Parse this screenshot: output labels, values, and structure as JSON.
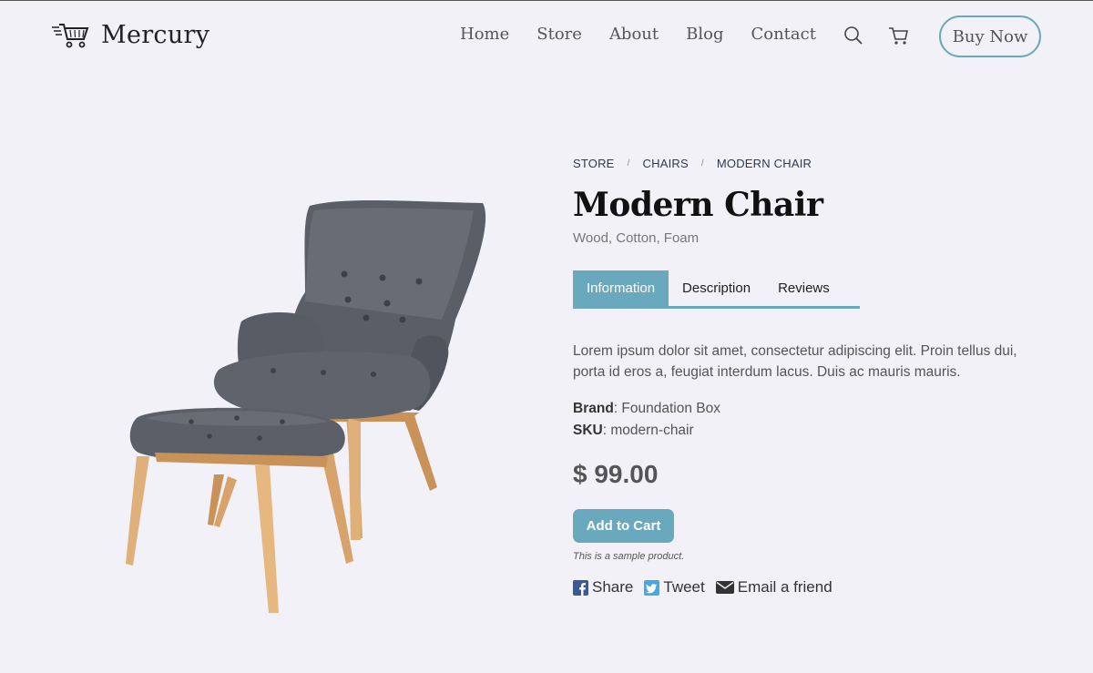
{
  "header": {
    "brand": "Mercury",
    "nav": [
      "Home",
      "Store",
      "About",
      "Blog",
      "Contact"
    ],
    "buy_now": "Buy Now"
  },
  "breadcrumb": [
    "STORE",
    "CHAIRS",
    "MODERN CHAIR"
  ],
  "product": {
    "title": "Modern Chair",
    "materials": "Wood, Cotton, Foam",
    "tabs": [
      "Information",
      "Description",
      "Reviews"
    ],
    "active_tab": "Information",
    "description": "Lorem ipsum dolor sit amet, consectetur adipiscing elit. Proin tellus dui, porta id eros a, feugiat interdum lacus. Duis ac mauris mauris.",
    "brand_label": "Brand",
    "brand_value": ": Foundation Box",
    "sku_label": "SKU",
    "sku_value": ": modern-chair",
    "price": "$ 99.00",
    "add_to_cart": "Add to Cart",
    "sample_note": "This is a sample product."
  },
  "share": {
    "facebook": "Share",
    "twitter": "Tweet",
    "email": "Email a friend"
  },
  "colors": {
    "accent": "#6aa9bd",
    "background": "#f1f1f7",
    "facebook": "#3b5998",
    "twitter": "#4aa8e0"
  }
}
